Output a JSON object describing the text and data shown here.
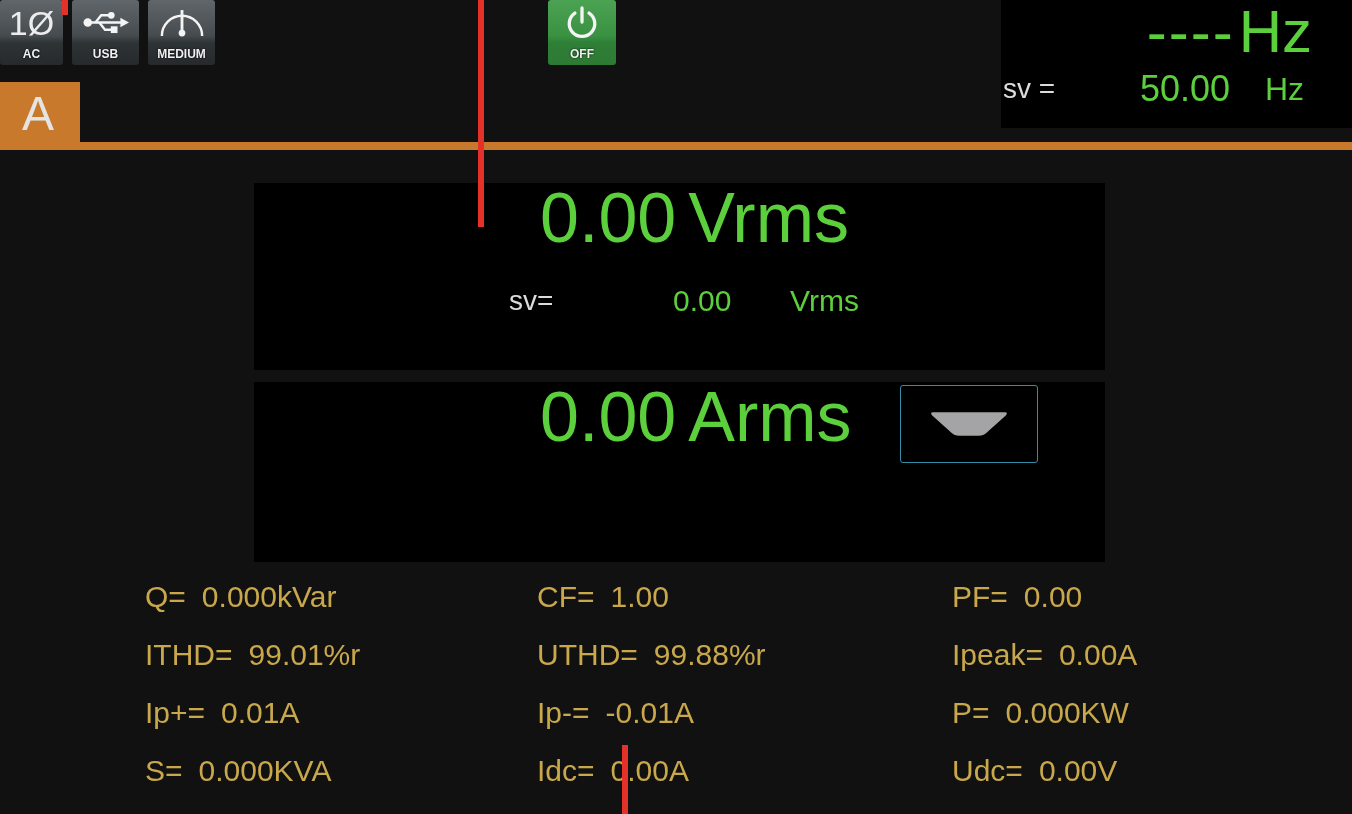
{
  "status_icons": [
    {
      "kind": "phase",
      "symbol": "1Ø",
      "label": "AC"
    },
    {
      "kind": "usb",
      "label": "USB"
    },
    {
      "kind": "gauge",
      "label": "MEDIUM"
    }
  ],
  "power_button": {
    "label": "OFF"
  },
  "frequency_panel": {
    "value": "----",
    "unit": "Hz",
    "sv_label": "sv =",
    "sv_value": "50.00",
    "sv_unit": "Hz"
  },
  "channel_tab": {
    "label": "A"
  },
  "voltage_panel": {
    "value": "0.00",
    "unit": "Vrms",
    "sv_label": "sv=",
    "sv_value": "0.00",
    "sv_unit": "Vrms"
  },
  "current_panel": {
    "value": "0.00",
    "unit": "Arms"
  },
  "measurements": [
    {
      "label": "Q=",
      "value": "0.000kVar"
    },
    {
      "label": "CF=",
      "value": "1.00"
    },
    {
      "label": "PF=",
      "value": "0.00"
    },
    {
      "label": "ITHD=",
      "value": "99.01%r"
    },
    {
      "label": "UTHD=",
      "value": "99.88%r"
    },
    {
      "label": "Ipeak=",
      "value": "0.00A"
    },
    {
      "label": "Ip+=",
      "value": "0.01A"
    },
    {
      "label": "Ip-=",
      "value": "-0.01A"
    },
    {
      "label": "P=",
      "value": "0.000KW"
    },
    {
      "label": "S=",
      "value": "0.000KVA"
    },
    {
      "label": "Idc=",
      "value": "0.00A"
    },
    {
      "label": "Udc=",
      "value": "0.00V"
    }
  ]
}
